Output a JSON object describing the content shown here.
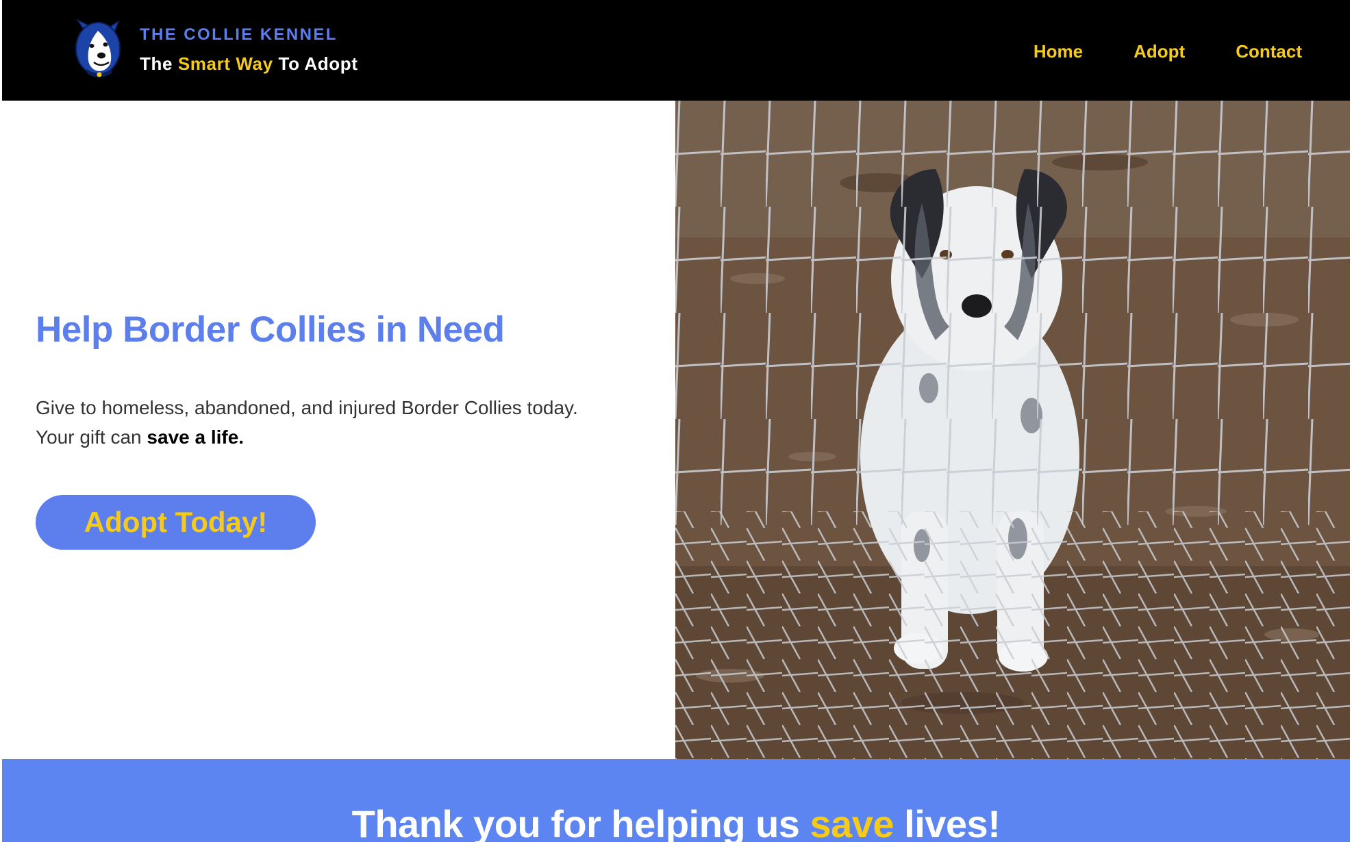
{
  "header": {
    "brand_title": "THE COLLIE KENNEL",
    "tagline": {
      "part1": "The ",
      "accent": "Smart Way",
      "part2": " To Adopt"
    },
    "logo_icon": "collie-dog-logo",
    "nav": [
      {
        "label": "Home"
      },
      {
        "label": "Adopt"
      },
      {
        "label": "Contact"
      }
    ]
  },
  "hero": {
    "title": "Help Border Collies in Need",
    "description_line1": "Give to homeless, abandoned, and injured Border Collies today.",
    "description_line2_prefix": "Your gift can ",
    "description_line2_bold": "save a life.",
    "cta_label": "Adopt Today!",
    "photo_icon": "border-collie-behind-fence-photo"
  },
  "banner": {
    "part1": "Thank you for helping us ",
    "accent": "save",
    "part2": " lives!"
  },
  "colors": {
    "brand_blue": "#5d7fee",
    "brand_yellow": "#f5cb1b",
    "header_bg": "#000000",
    "banner_bg": "#5d85f2"
  }
}
